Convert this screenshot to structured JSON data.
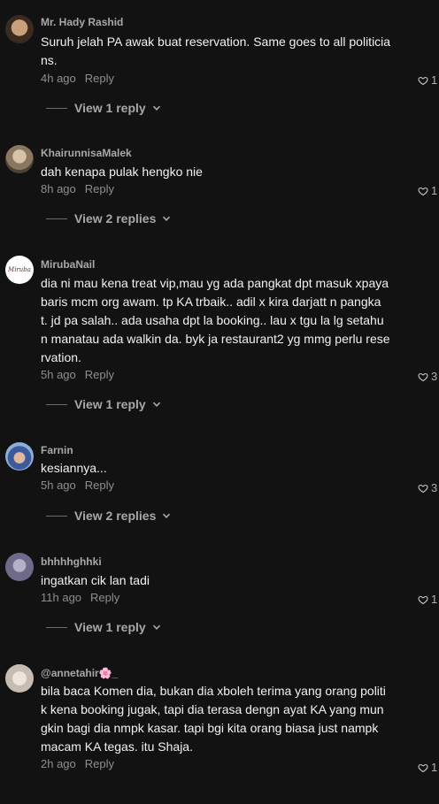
{
  "comments": [
    {
      "username": "Mr. Hady Rashid",
      "text": "Suruh jelah PA awak buat reservation. Same goes to all politicia\nns.",
      "time": "4h ago",
      "reply_label": "Reply",
      "likes": "1",
      "view_replies": "View 1 reply"
    },
    {
      "username": "KhairunnisaMalek",
      "text": "dah kenapa pulak hengko nie",
      "time": "8h ago",
      "reply_label": "Reply",
      "likes": "1",
      "view_replies": "View 2 replies"
    },
    {
      "username": "MirubaNail",
      "avatar_text": "Miruba",
      "text": "dia ni mau kena treat vip,mau yg ada pangkat dpt masuk xpaya\nbaris mcm org awam. tp KA trbaik.. adil x kira darjatt n pangka\nt. jd pa salah.. ada usaha dpt la booking.. lau x tgu la lg setahu\nn manatau ada walkin da. byk ja restaurant2 yg mmg perlu rese\nrvation.",
      "time": "5h ago",
      "reply_label": "Reply",
      "likes": "3",
      "view_replies": "View 1 reply"
    },
    {
      "username": "Farnin",
      "text": "kesiannya...",
      "time": "5h ago",
      "reply_label": "Reply",
      "likes": "3",
      "view_replies": "View 2 replies"
    },
    {
      "username": "bhhhhghhki",
      "text": "ingatkan cik lan tadi",
      "time": "11h ago",
      "reply_label": "Reply",
      "likes": "1",
      "view_replies": "View 1 reply"
    },
    {
      "username": "@annetahir🌸_",
      "text": "bila baca Komen dia, bukan dia xboleh terima yang orang politi\nk kena booking jugak, tapi dia terasa dengn ayat KA yang mun\ngkin bagi dia nmpk kasar. tapi bgi kita orang biasa just nampk\nmacam KA tegas. itu Shaja.",
      "time": "2h ago",
      "reply_label": "Reply",
      "likes": "1"
    }
  ],
  "colors": {
    "background": "#121212",
    "text": "#f1f1f1",
    "muted": "#8e8e8e"
  }
}
